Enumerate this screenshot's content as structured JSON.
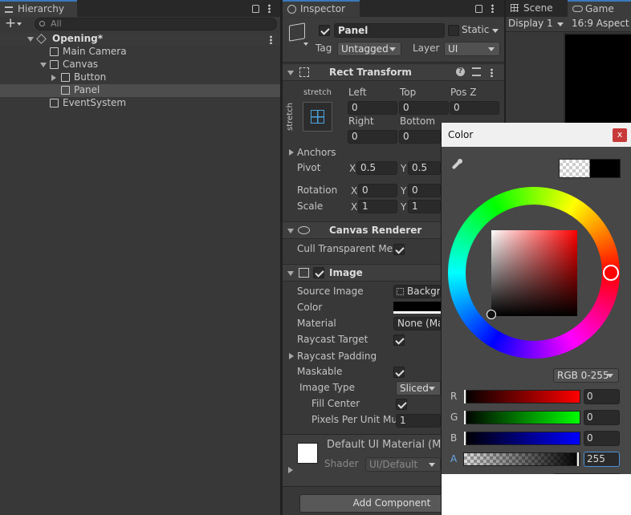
{
  "hierarchy": {
    "tab_label": "Hierarchy",
    "search_placeholder": "All",
    "add_label": "+",
    "scene": "Opening*",
    "items": [
      {
        "label": "Main Camera"
      },
      {
        "label": "Canvas"
      },
      {
        "label": "Button"
      },
      {
        "label": "Panel"
      },
      {
        "label": "EventSystem"
      }
    ]
  },
  "inspector": {
    "tab_label": "Inspector",
    "object_name": "Panel",
    "static_label": "Static",
    "tag_label": "Tag",
    "tag_value": "Untagged",
    "layer_label": "Layer",
    "layer_value": "UI",
    "rect_transform": {
      "title": "Rect Transform",
      "stretch_top": "stretch",
      "stretch_side": "stretch",
      "left_label": "Left",
      "left_value": "0",
      "top_label": "Top",
      "top_value": "0",
      "posz_label": "Pos Z",
      "posz_value": "0",
      "right_label": "Right",
      "right_value": "0",
      "bottom_label": "Bottom",
      "bottom_value": "0",
      "anchors_label": "Anchors",
      "pivot_label": "Pivot",
      "pivot_x": "0.5",
      "pivot_y": "0.5",
      "rotation_label": "Rotation",
      "rotation_x": "0",
      "rotation_y": "0",
      "scale_label": "Scale",
      "scale_x": "1",
      "scale_y": "1",
      "x_label": "X",
      "y_label": "Y"
    },
    "canvas_renderer": {
      "title": "Canvas Renderer",
      "cull_label": "Cull Transparent Mes"
    },
    "image": {
      "title": "Image",
      "source_label": "Source Image",
      "source_value": "Backgr",
      "color_label": "Color",
      "material_label": "Material",
      "material_value": "None (Ma",
      "raycast_target_label": "Raycast Target",
      "raycast_padding_label": "Raycast Padding",
      "maskable_label": "Maskable",
      "image_type_label": "Image Type",
      "image_type_value": "Sliced",
      "fill_center_label": "Fill Center",
      "ppu_label": "Pixels Per Unit Mu",
      "ppu_value": "1"
    },
    "material_preview": {
      "title": "Default UI Material (M",
      "shader_label": "Shader",
      "shader_value": "UI/Default"
    },
    "add_component_label": "Add Component"
  },
  "scene_tab": {
    "label": "Scene"
  },
  "game_tab": {
    "label": "Game",
    "display": "Display 1",
    "aspect": "16:9 Aspect"
  },
  "color_picker": {
    "title": "Color",
    "close": "x",
    "mode": "RGB 0-255",
    "channels": [
      {
        "label": "R",
        "value": "0"
      },
      {
        "label": "G",
        "value": "0"
      },
      {
        "label": "B",
        "value": "0"
      },
      {
        "label": "A",
        "value": "255"
      }
    ]
  }
}
